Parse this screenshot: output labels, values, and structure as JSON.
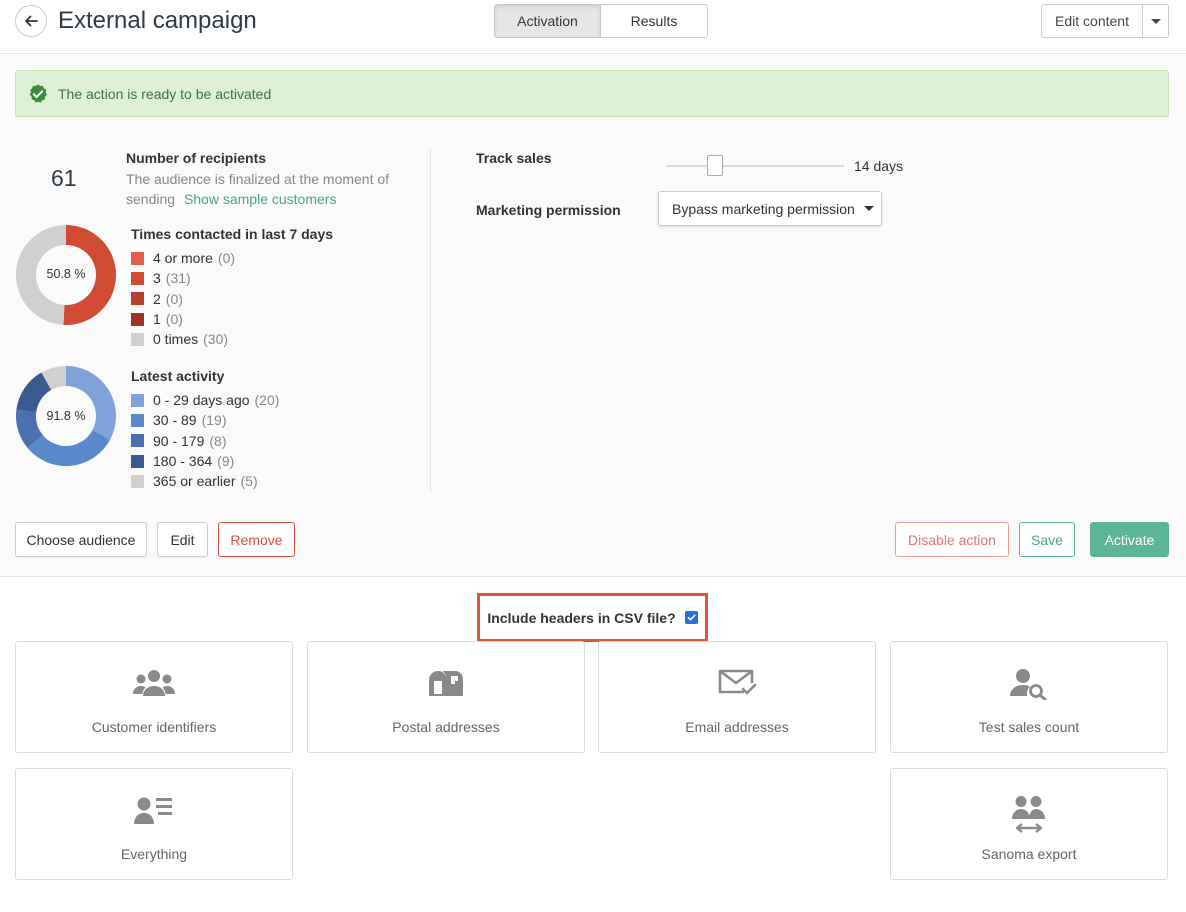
{
  "header": {
    "title": "External campaign",
    "tabs": [
      {
        "label": "Activation"
      },
      {
        "label": "Results"
      }
    ],
    "edit_content_label": "Edit content"
  },
  "alert": {
    "text": "The action is ready to be activated"
  },
  "recipients": {
    "count": "61",
    "title": "Number of recipients",
    "description": "The audience is finalized at the moment of sending",
    "sample_link": "Show sample customers"
  },
  "times_contacted": {
    "title": "Times contacted in last 7 days",
    "percent_label": "50.8 %",
    "items": [
      {
        "label": "4 or more",
        "count": "(0)",
        "value": 0,
        "color": "#e0604d"
      },
      {
        "label": "3",
        "count": "(31)",
        "value": 31,
        "color": "#d14a33"
      },
      {
        "label": "2",
        "count": "(0)",
        "value": 0,
        "color": "#b8402d"
      },
      {
        "label": "1",
        "count": "(0)",
        "value": 0,
        "color": "#9c3526"
      },
      {
        "label": "0 times",
        "count": "(30)",
        "value": 30,
        "color": "#d0d0d0"
      }
    ]
  },
  "latest_activity": {
    "title": "Latest activity",
    "percent_label": "91.8 %",
    "items": [
      {
        "label": "0 - 29 days ago",
        "count": "(20)",
        "value": 20,
        "color": "#7fa3d8"
      },
      {
        "label": "30 - 89",
        "count": "(19)",
        "value": 19,
        "color": "#5c88cc"
      },
      {
        "label": "90 - 179",
        "count": "(8)",
        "value": 8,
        "color": "#4a70b0"
      },
      {
        "label": "180 - 364",
        "count": "(9)",
        "value": 9,
        "color": "#3a5a90"
      },
      {
        "label": "365 or earlier",
        "count": "(5)",
        "value": 5,
        "color": "#d0d0d0"
      }
    ]
  },
  "track_sales": {
    "label": "Track sales",
    "value_label": "14 days",
    "value": 14
  },
  "marketing_permission": {
    "label": "Marketing permission",
    "selected": "Bypass marketing permission"
  },
  "buttons": {
    "choose_audience": "Choose audience",
    "edit": "Edit",
    "remove": "Remove",
    "disable_action": "Disable action",
    "save": "Save",
    "activate": "Activate"
  },
  "csv": {
    "label": "Include headers in CSV file?",
    "checked": true
  },
  "exports": [
    {
      "label": "Customer identifiers",
      "icon": "users-icon"
    },
    {
      "label": "Postal addresses",
      "icon": "mailbox-icon"
    },
    {
      "label": "Email addresses",
      "icon": "envelope-check-icon"
    },
    {
      "label": "Test sales count",
      "icon": "user-search-icon"
    },
    {
      "label": "Everything",
      "icon": "user-list-icon"
    },
    {
      "label": "Sanoma export",
      "icon": "users-transfer-icon"
    }
  ]
}
